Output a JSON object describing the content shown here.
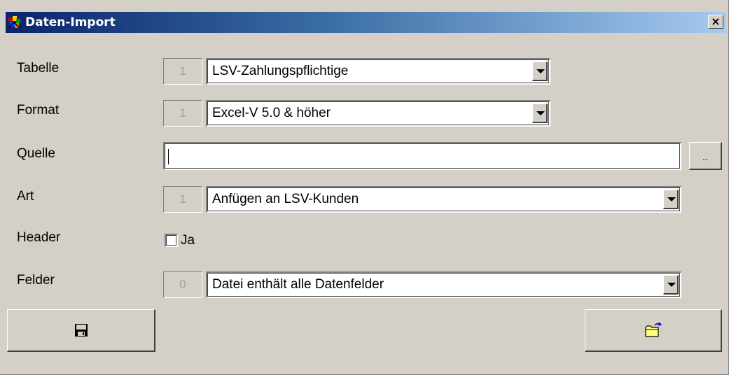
{
  "window": {
    "title": "Daten-Import",
    "close_label": "×",
    "app_icon": "colorful-app-icon"
  },
  "form": {
    "tabelle": {
      "label": "Tabelle",
      "number": "1",
      "value": "LSV-Zahlungspflichtige"
    },
    "format": {
      "label": "Format",
      "number": "1",
      "value": "Excel-V 5.0 & höher"
    },
    "quelle": {
      "label": "Quelle",
      "value": "",
      "browse_label": ".."
    },
    "art": {
      "label": "Art",
      "number": "1",
      "value": "Anfügen an LSV-Kunden"
    },
    "header": {
      "label": "Header",
      "checkbox_label": "Ja",
      "checked": false
    },
    "felder": {
      "label": "Felder",
      "number": "0",
      "value": "Datei enthält alle Datenfelder"
    }
  },
  "buttons": {
    "save_icon": "floppy-disk-icon",
    "open_icon": "open-folder-icon"
  }
}
